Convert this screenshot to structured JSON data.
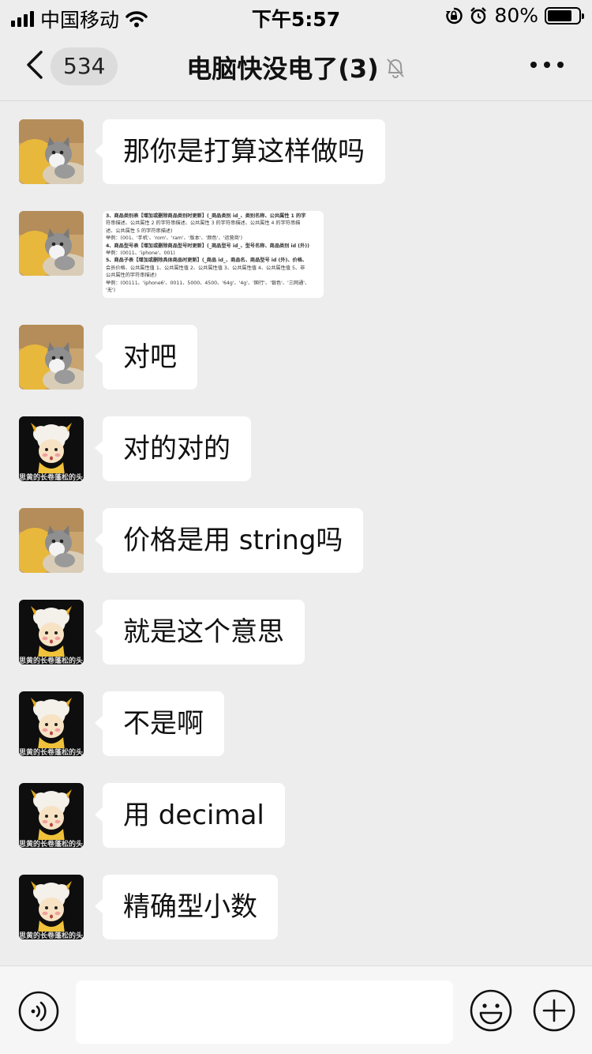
{
  "status_bar": {
    "carrier": "中国移动",
    "time": "下午5:57",
    "battery_percent": "80%",
    "battery_level": 0.8,
    "icons": [
      "signal-icon",
      "wifi-icon",
      "rotation-lock-icon",
      "alarm-icon",
      "battery-icon"
    ]
  },
  "nav": {
    "unread_count": "534",
    "title": "电脑快没电了(3)",
    "icons": [
      "back-chevron-icon",
      "mute-bell-icon",
      "more-dots-icon"
    ]
  },
  "messages": [
    {
      "sender": "cat",
      "type": "text",
      "text": "那你是打算这样做吗"
    },
    {
      "sender": "cat",
      "type": "image",
      "image_lines": [
        "3、商品类别表【增加或删除商品类别时更新】(_商品类别 id_、类别名称、公共属性 1 的字",
        "符串描述、公共属性 2 的字符串描述、公共属性 3 的字符串描述、公共属性 4 的字符串描",
        "述、公共属性 5 的字符串描述)",
        "举例：(001、'手机'、'rom'、'ram'、'版本'、'颜色'、'运营商')",
        "4、商品型号表【增加或删除商品型号时更新】(_商品型号 id_、型号名称、商品类别 id (外))",
        "举例：(0011、'iphone'、001)",
        "5、商品子表【增加或删除具体商品时更新】(_商品 id_、商品名、商品型号 id (外)、价格、",
        "会员价格、公共属性值 1、公共属性值 2、公共属性值 3、公共属性值 4、公共属性值 5、非",
        "公共属性的字符串描述)",
        "举例：(00111、'iphone6'、0011、5000、4500、'64g'、'4g'、'国行'、'银色'、'三网通'、",
        "'无')"
      ]
    },
    {
      "sender": "cat",
      "type": "text",
      "text": "对吧"
    },
    {
      "sender": "sheep",
      "type": "text",
      "text": "对的对的"
    },
    {
      "sender": "cat",
      "type": "text",
      "text": "价格是用 string吗"
    },
    {
      "sender": "sheep",
      "type": "text",
      "text": "就是这个意思"
    },
    {
      "sender": "sheep",
      "type": "text",
      "text": "不是啊"
    },
    {
      "sender": "sheep",
      "type": "text",
      "text": "用 decimal"
    },
    {
      "sender": "sheep",
      "type": "text",
      "text": "精确型小数"
    }
  ],
  "avatars": {
    "cat": {
      "icon": "cat-avatar-icon"
    },
    "sheep": {
      "icon": "sheep-avatar-icon",
      "caption": "思黄的长卷蓬松的头发"
    }
  },
  "input_bar": {
    "text_value": "",
    "icons": [
      "voice-icon",
      "emoji-icon",
      "plus-icon"
    ]
  },
  "colors": {
    "background": "#ededed",
    "bubble": "#ffffff",
    "nav_pill": "#dcdcdc"
  }
}
